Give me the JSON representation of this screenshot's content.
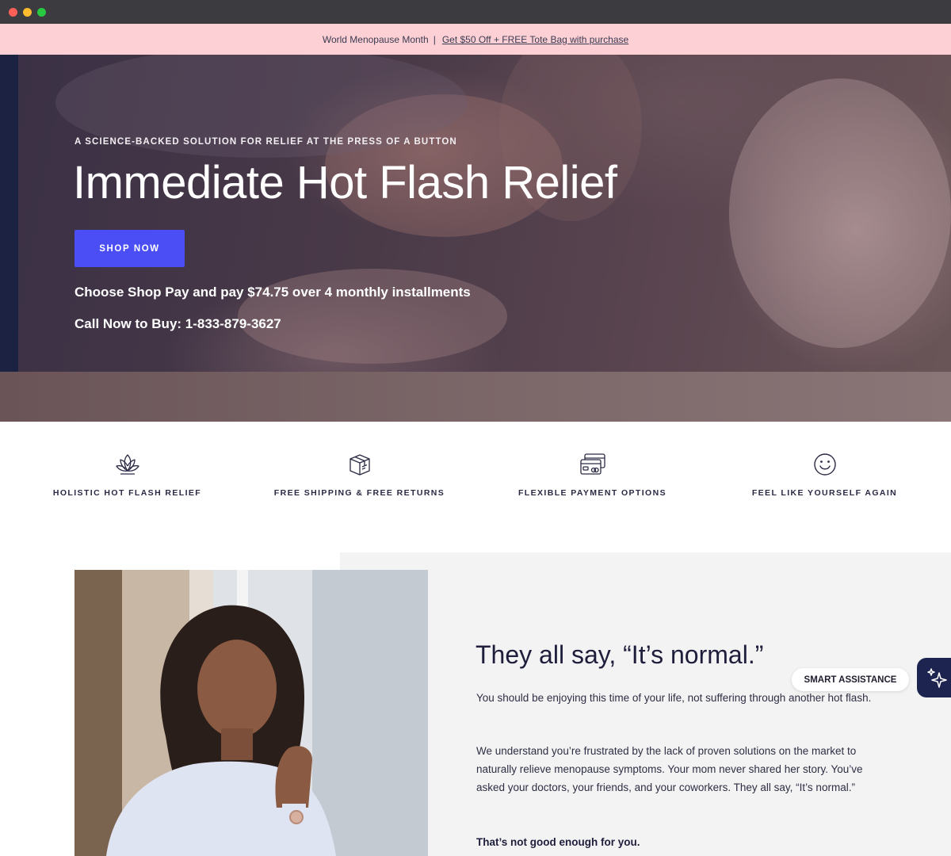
{
  "announcement": {
    "text": "World Menopause Month",
    "separator": "|",
    "link": "Get $50 Off + FREE Tote Bag with purchase"
  },
  "hero": {
    "eyebrow": "A SCIENCE-BACKED SOLUTION FOR RELIEF AT THE PRESS OF A BUTTON",
    "title": "Immediate Hot Flash Relief",
    "cta": "SHOP NOW",
    "installments": "Choose Shop Pay and pay $74.75 over 4 monthly installments",
    "phone": "Call Now to Buy: 1-833-879-3627"
  },
  "features": [
    {
      "label": "HOLISTIC HOT FLASH RELIEF",
      "icon": "lotus-icon"
    },
    {
      "label": "FREE SHIPPING & FREE RETURNS",
      "icon": "box-icon"
    },
    {
      "label": "FLEXIBLE PAYMENT OPTIONS",
      "icon": "credit-card-icon"
    },
    {
      "label": "FEEL LIKE YOURSELF AGAIN",
      "icon": "smiley-icon"
    }
  ],
  "story": {
    "heading": "They all say, “It’s normal.”",
    "p1": "You should be enjoying this time of your life, not suffering through another hot flash.",
    "p2": "We understand you’re frustrated by the lack of proven solutions on the market to naturally relieve menopause symptoms. Your mom never shared her story. You’ve asked your doctors, your friends, and your coworkers. They all say, “It’s normal.”",
    "p3": "That’s not good enough for you."
  },
  "assistant": {
    "label": "SMART ASSISTANCE",
    "icon": "sparkle-icon"
  },
  "colors": {
    "announcement_bg": "#fdd0d6",
    "cta": "#4a4ef4",
    "navy": "#1e2450",
    "text": "#1e1e3c"
  }
}
